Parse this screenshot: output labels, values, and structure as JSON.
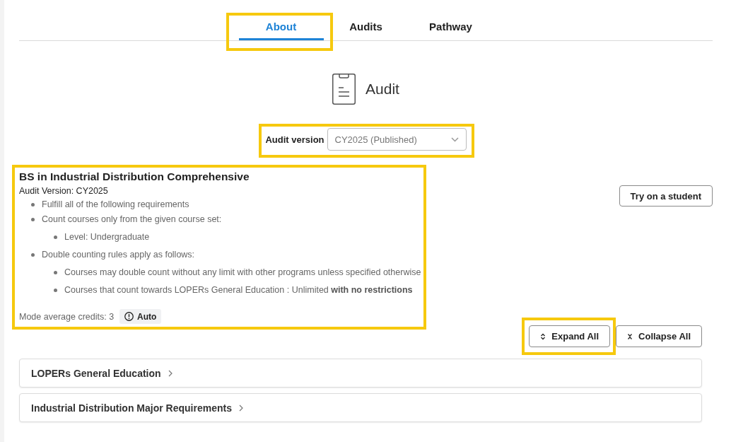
{
  "tabs": [
    {
      "label": "About",
      "selected": true,
      "highlighted": true
    },
    {
      "label": "Audits",
      "selected": false,
      "highlighted": false
    },
    {
      "label": "Pathway",
      "selected": false,
      "highlighted": false
    }
  ],
  "heading": {
    "title": "Audit"
  },
  "audit_version": {
    "label": "Audit version",
    "value": "CY2025 (Published)",
    "highlighted": true
  },
  "program": {
    "title": "BS in Industrial Distribution Comprehensive",
    "version": "Audit Version: CY2025",
    "rules": [
      {
        "text": "Fulfill all of the following requirements"
      },
      {
        "text": "Count courses only from the given course set:",
        "children": [
          {
            "text": "Level: Undergraduate"
          }
        ]
      },
      {
        "text": "Double counting rules apply as follows:",
        "children": [
          {
            "text": "Courses may double count without any limit with other programs unless specified otherwise"
          },
          {
            "text": "Courses that count towards LOPERs General Education : Unlimited **with no restrictions**"
          }
        ]
      }
    ],
    "credits": "Mode average credits: 3",
    "mode": "Auto",
    "highlighted": true
  },
  "try_button": {
    "label": "Try on a student"
  },
  "expand_all": {
    "label": "Expand All",
    "highlighted": true
  },
  "collapse_all": {
    "label": "Collapse All",
    "highlighted": false
  },
  "sections": [
    {
      "title": "LOPERs General Education",
      "expanded": false
    },
    {
      "title": "Industrial Distribution Major Requirements",
      "expanded": false
    }
  ]
}
